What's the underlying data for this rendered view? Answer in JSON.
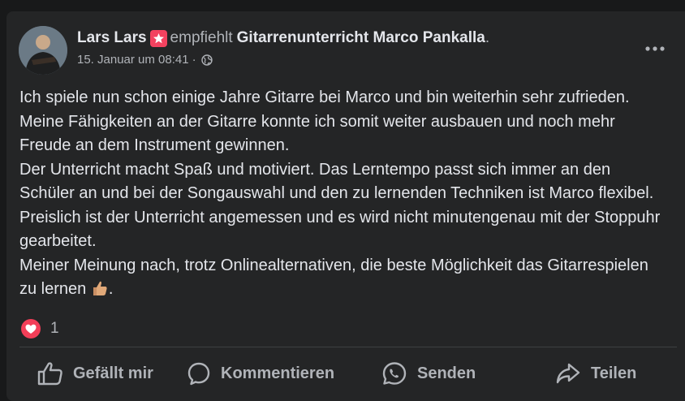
{
  "post": {
    "author": "Lars Lars",
    "action_text": "empfiehlt",
    "page_name": "Gitarrenunterricht Marco Pankalla",
    "page_suffix": ".",
    "timestamp": "15. Januar um 08:41",
    "separator": "·",
    "privacy_icon": "globe-icon",
    "body": "Ich spiele nun schon einige Jahre Gitarre bei Marco und bin weiterhin sehr zufrieden. Meine Fähigkeiten an der Gitarre konnte ich somit weiter ausbauen und noch mehr Freude an dem Instrument gewinnen.\nDer Unterricht macht Spaß und motiviert. Das Lerntempo passt sich immer an den Schüler an und bei der Songauswahl und den zu lernenden Techniken ist Marco flexibel. Preislich ist der Unterricht angemessen und es wird nicht minutengenau mit der Stoppuhr gearbeitet.\nMeiner Meinung nach, trotz Onlinealternativen, die beste Möglichkeit das Gitarrespielen zu lernen",
    "body_end": ".",
    "body_emoji": "thumbs-up-emoji"
  },
  "reactions": {
    "type": "love",
    "count": "1"
  },
  "actions": {
    "like": "Gefällt mir",
    "comment": "Kommentieren",
    "send": "Senden",
    "share": "Teilen"
  },
  "colors": {
    "background": "#18191a",
    "card": "#242526",
    "text_primary": "#e4e6eb",
    "text_secondary": "#b0b3b8",
    "love": "#f33e58",
    "badge": "#f3425f"
  }
}
